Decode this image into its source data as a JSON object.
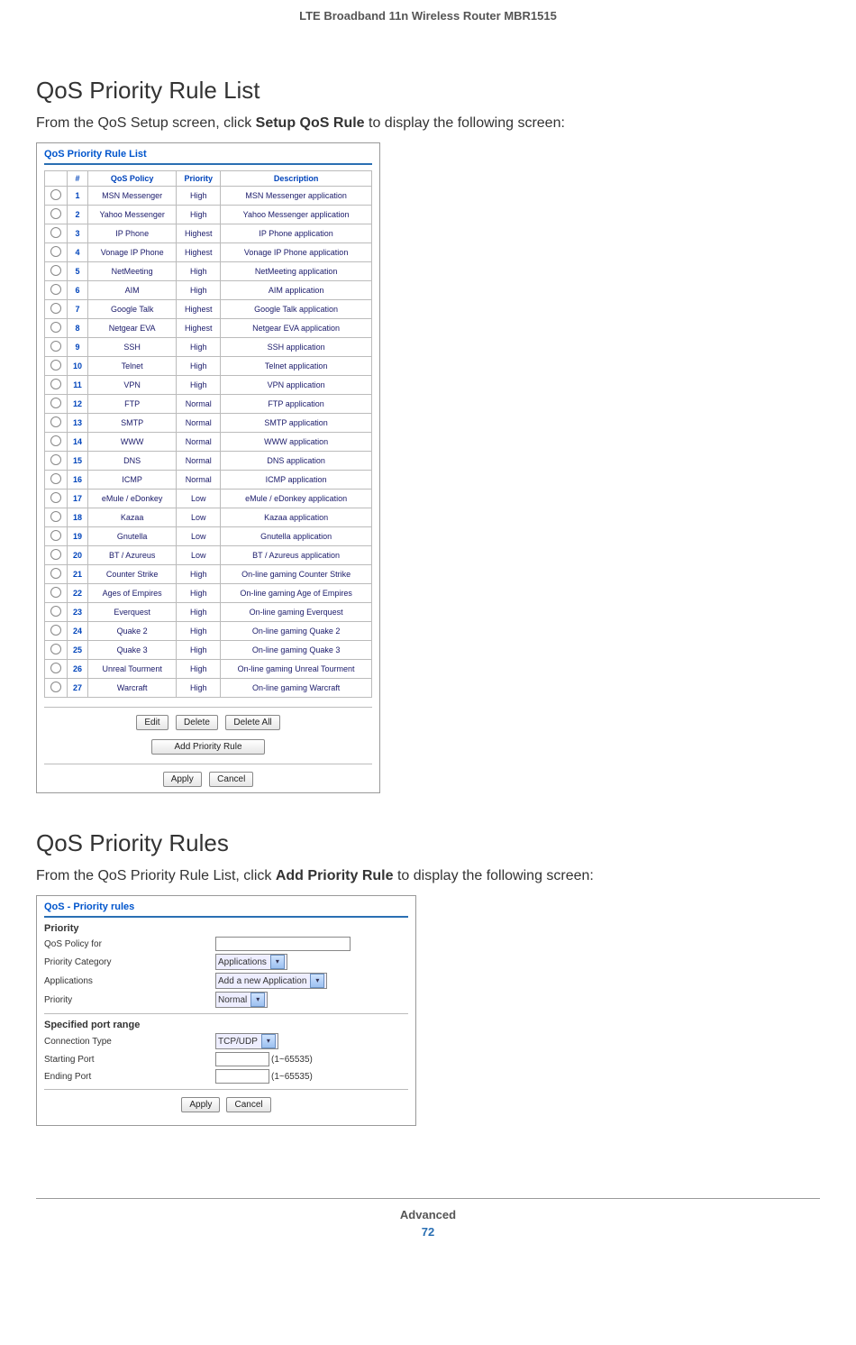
{
  "header": "LTE Broadband 11n Wireless Router MBR1515",
  "section1": {
    "title": "QoS Priority Rule List",
    "intro_pre": "From the QoS Setup screen, click ",
    "intro_bold": "Setup QoS Rule",
    "intro_post": " to display the following screen:",
    "panel_title": "QoS Priority Rule List",
    "columns": {
      "c0": "",
      "c1": "#",
      "c2": "QoS Policy",
      "c3": "Priority",
      "c4": "Description"
    },
    "rows": [
      {
        "n": "1",
        "policy": "MSN Messenger",
        "priority": "High",
        "desc": "MSN Messenger application"
      },
      {
        "n": "2",
        "policy": "Yahoo Messenger",
        "priority": "High",
        "desc": "Yahoo Messenger application"
      },
      {
        "n": "3",
        "policy": "IP Phone",
        "priority": "Highest",
        "desc": "IP Phone application"
      },
      {
        "n": "4",
        "policy": "Vonage IP Phone",
        "priority": "Highest",
        "desc": "Vonage IP Phone application"
      },
      {
        "n": "5",
        "policy": "NetMeeting",
        "priority": "High",
        "desc": "NetMeeting application"
      },
      {
        "n": "6",
        "policy": "AIM",
        "priority": "High",
        "desc": "AIM application"
      },
      {
        "n": "7",
        "policy": "Google Talk",
        "priority": "Highest",
        "desc": "Google Talk application"
      },
      {
        "n": "8",
        "policy": "Netgear EVA",
        "priority": "Highest",
        "desc": "Netgear EVA application"
      },
      {
        "n": "9",
        "policy": "SSH",
        "priority": "High",
        "desc": "SSH application"
      },
      {
        "n": "10",
        "policy": "Telnet",
        "priority": "High",
        "desc": "Telnet application"
      },
      {
        "n": "11",
        "policy": "VPN",
        "priority": "High",
        "desc": "VPN application"
      },
      {
        "n": "12",
        "policy": "FTP",
        "priority": "Normal",
        "desc": "FTP application"
      },
      {
        "n": "13",
        "policy": "SMTP",
        "priority": "Normal",
        "desc": "SMTP application"
      },
      {
        "n": "14",
        "policy": "WWW",
        "priority": "Normal",
        "desc": "WWW application"
      },
      {
        "n": "15",
        "policy": "DNS",
        "priority": "Normal",
        "desc": "DNS application"
      },
      {
        "n": "16",
        "policy": "ICMP",
        "priority": "Normal",
        "desc": "ICMP application"
      },
      {
        "n": "17",
        "policy": "eMule / eDonkey",
        "priority": "Low",
        "desc": "eMule / eDonkey application"
      },
      {
        "n": "18",
        "policy": "Kazaa",
        "priority": "Low",
        "desc": "Kazaa application"
      },
      {
        "n": "19",
        "policy": "Gnutella",
        "priority": "Low",
        "desc": "Gnutella application"
      },
      {
        "n": "20",
        "policy": "BT / Azureus",
        "priority": "Low",
        "desc": "BT / Azureus application"
      },
      {
        "n": "21",
        "policy": "Counter Strike",
        "priority": "High",
        "desc": "On-line gaming Counter Strike"
      },
      {
        "n": "22",
        "policy": "Ages of Empires",
        "priority": "High",
        "desc": "On-line gaming Age of Empires"
      },
      {
        "n": "23",
        "policy": "Everquest",
        "priority": "High",
        "desc": "On-line gaming Everquest"
      },
      {
        "n": "24",
        "policy": "Quake 2",
        "priority": "High",
        "desc": "On-line gaming Quake 2"
      },
      {
        "n": "25",
        "policy": "Quake 3",
        "priority": "High",
        "desc": "On-line gaming Quake 3"
      },
      {
        "n": "26",
        "policy": "Unreal Tourment",
        "priority": "High",
        "desc": "On-line gaming Unreal Tourment"
      },
      {
        "n": "27",
        "policy": "Warcraft",
        "priority": "High",
        "desc": "On-line gaming Warcraft"
      }
    ],
    "buttons": {
      "edit": "Edit",
      "delete": "Delete",
      "delete_all": "Delete All",
      "add": "Add Priority Rule",
      "apply": "Apply",
      "cancel": "Cancel"
    }
  },
  "section2": {
    "title": "QoS Priority Rules",
    "intro_pre": "From the QoS Priority Rule List, click ",
    "intro_bold": "Add Priority Rule",
    "intro_post": " to display the following screen:",
    "panel_title": "QoS - Priority rules",
    "labels": {
      "priority_hdr": "Priority",
      "policy_for": "QoS Policy for",
      "category": "Priority Category",
      "applications": "Applications",
      "priority": "Priority",
      "port_hdr": "Specified port range",
      "conn_type": "Connection Type",
      "start_port": "Starting Port",
      "end_port": "Ending Port",
      "port_hint": "(1~65535)"
    },
    "values": {
      "category": "Applications",
      "applications": "Add a new Application",
      "priority": "Normal",
      "conn_type": "TCP/UDP"
    },
    "buttons": {
      "apply": "Apply",
      "cancel": "Cancel"
    }
  },
  "footer": {
    "chapter": "Advanced",
    "page": "72"
  }
}
